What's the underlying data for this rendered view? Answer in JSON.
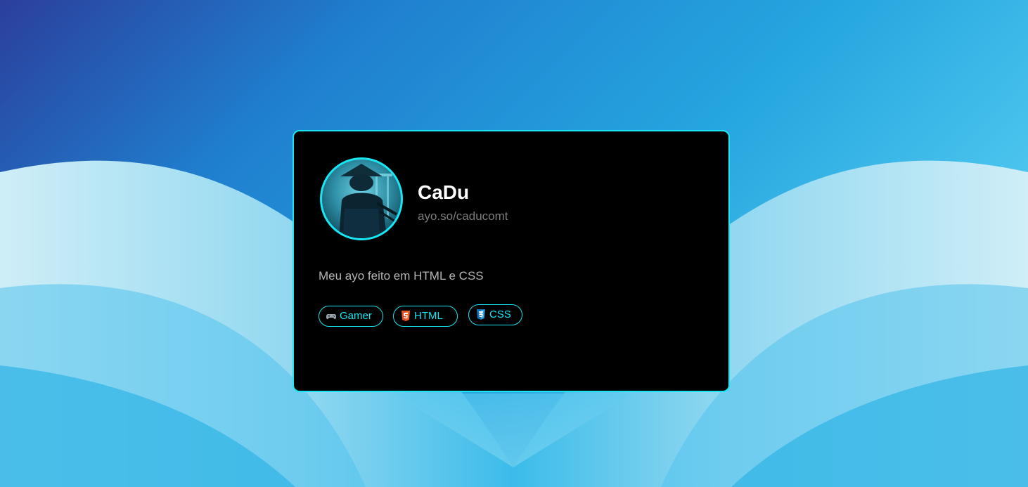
{
  "profile": {
    "name": "CaDu",
    "handle": "ayo.so/caducomt",
    "bio": "Meu ayo feito em HTML e CSS",
    "avatar_icon": "samurai-avatar"
  },
  "tags": [
    {
      "label": "Gamer",
      "icon": "gamepad-icon"
    },
    {
      "label": "HTML",
      "icon": "html5-icon"
    },
    {
      "label": "CSS",
      "icon": "css3-icon"
    }
  ],
  "colors": {
    "accent": "#18e6f2",
    "card_background": "#000000",
    "name": "#ffffff",
    "handle": "#7c7c7c",
    "bio": "#b5b5b5",
    "html_orange": "#e44d26",
    "css_blue": "#1572b6"
  }
}
